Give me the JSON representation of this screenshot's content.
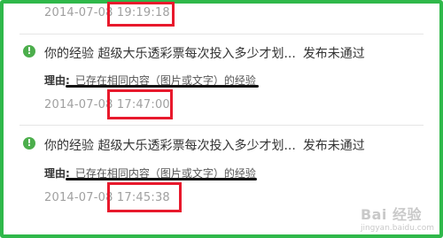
{
  "entries": [
    {
      "date": "2014-07-08",
      "time": "19:19:18"
    },
    {
      "title": "你的经验 超级大乐透彩票每次投入多少才划...",
      "status": "发布未通过",
      "reason_label": "理由:",
      "reason_text": "已存在相同内容（图片或文字）的经验",
      "date": "2014-07-08",
      "time": "17:47:00"
    },
    {
      "title": "你的经验 超级大乐透彩票每次投入多少才划...",
      "status": "发布未通过",
      "reason_label": "理由:",
      "reason_text": "已存在相同内容（图片或文字）的经验",
      "date": "2014-07-08",
      "time": "17:45:38"
    }
  ],
  "watermark": {
    "brand": "Bai 经验",
    "url": "jingyan.baidu.com"
  },
  "colors": {
    "frame": "#2fb84a",
    "highlight": "#e8192c",
    "status_icon": "#4cae4c"
  },
  "icons": {
    "status": "exclamation-circle-icon"
  }
}
